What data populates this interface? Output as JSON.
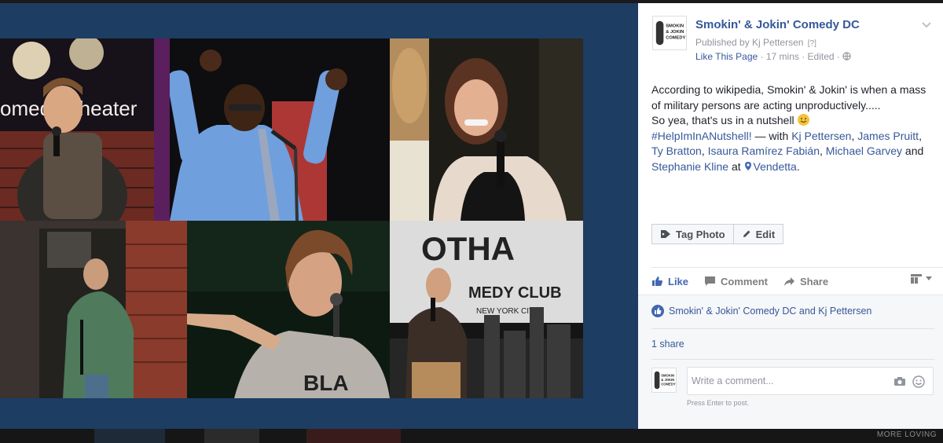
{
  "post": {
    "page_name": "Smokin' & Jokin' Comedy DC",
    "published_by": "Published by Kj Pettersen",
    "help_marker": "[?]",
    "like_page": "Like This Page",
    "meta_sep1": " · ",
    "time": "17 mins",
    "meta_sep2": " · ",
    "edited": "Edited",
    "meta_sep3": " · ",
    "body": {
      "line1": "According to wikipedia, Smokin' & Jokin' is when a mass of military persons are acting unproductively.....",
      "line2_prefix": "So yea, that's us in a nutshell ",
      "hashtag": "#HelpImInANutshell!",
      "with_text": " — with ",
      "people": [
        "Kj Pettersen",
        "James Pruitt",
        "Ty Bratton",
        "Isaura Ramírez Fabián",
        "Michael Garvey",
        "Stephanie Kline"
      ],
      "comma": ", ",
      "and_text": " and ",
      "at_text": " at ",
      "place": "Vendetta",
      "period": "."
    },
    "tag_photo_label": "Tag Photo",
    "edit_label": "Edit",
    "like_label": "Like",
    "comment_label": "Comment",
    "share_label": "Share",
    "likers_text": "Smokin' & Jokin' Comedy DC and Kj Pettersen",
    "shares_text": "1 share",
    "comment_placeholder": "Write a comment...",
    "comment_hint": "Press Enter to post."
  },
  "photo": {
    "tile_texts": {
      "theater_sign": "omedy Theater",
      "club_sign_top": "OTHA",
      "club_sign_mid": "MEDY CLUB",
      "club_sign_city": "NEW YORK CITY",
      "shirt_text": "BLA"
    }
  },
  "footer": {
    "more_link": "MORE LOVING"
  },
  "colors": {
    "brand_blue": "#365899",
    "like_blue": "#4267b2",
    "pane_blue": "#1d3d63"
  },
  "icons": [
    "chevron-down-icon",
    "globe-icon",
    "tag-icon",
    "pencil-icon",
    "thumbs-up-icon",
    "comment-icon",
    "share-arrow-icon",
    "view-as-icon",
    "like-badge-icon",
    "camera-icon",
    "emoji-icon",
    "location-pin-icon",
    "smiley-emoji-icon"
  ]
}
